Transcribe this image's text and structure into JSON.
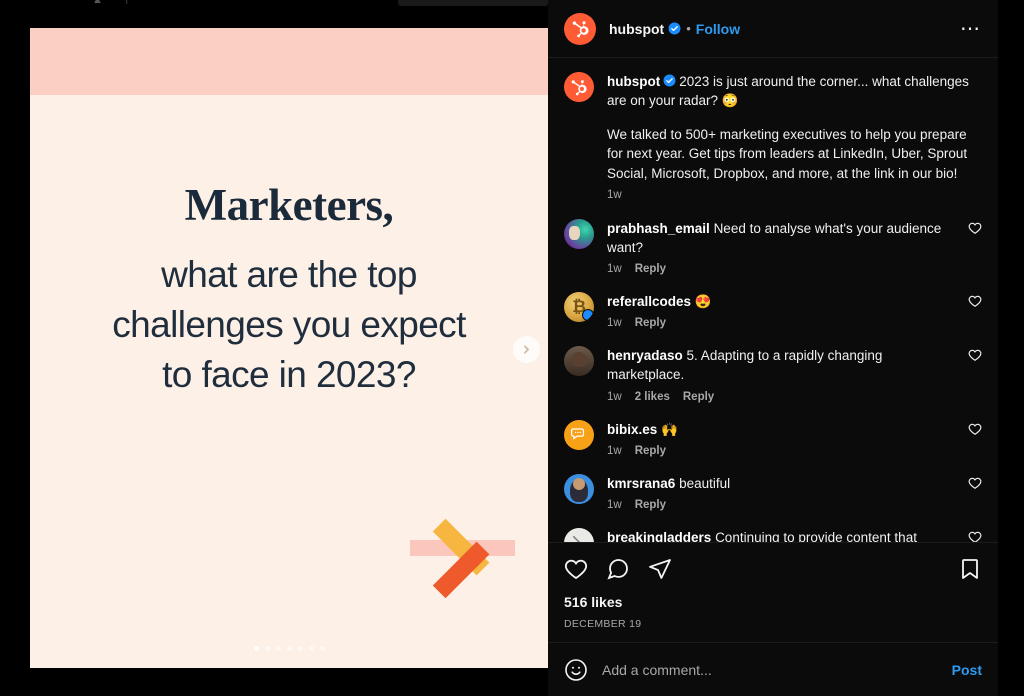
{
  "window": {
    "background": "#000000"
  },
  "stories_strip": {
    "visible_partial": true,
    "avatar_count": 6
  },
  "post_image": {
    "background": "#fdf1e7",
    "band_color": "#fbcfc3",
    "headline_serif": "Marketers,",
    "headline_line1": "what are the top",
    "headline_line2": "challenges you expect",
    "headline_line3": "to face in 2023?",
    "text_color": "#1f2d3d",
    "arrow": {
      "shaft_color": "#fbc7bc",
      "upper_color": "#f6b63f",
      "lower_color": "#ee5a2c"
    },
    "carousel": {
      "total_dots": 7,
      "active_index": 0
    },
    "next_button_icon": "chevron-right-icon"
  },
  "header": {
    "avatar_icon": "hubspot-logo-icon",
    "username": "hubspot",
    "verified_icon": "verified-badge-icon",
    "separator": "•",
    "follow_label": "Follow",
    "more_options_icon": "ellipsis-icon",
    "follow_color": "#2e9bf0"
  },
  "caption": {
    "avatar_icon": "hubspot-logo-icon",
    "username": "hubspot",
    "verified_icon": "verified-badge-icon",
    "line1": "2023 is just around the corner... what challenges are on your radar? 😳",
    "line2": "We talked to 500+ marketing executives to help you prepare for next year. Get tips from leaders at LinkedIn, Uber, Sprout Social, Microsoft, Dropbox, and more, at the link in our bio!",
    "time": "1w"
  },
  "comments": [
    {
      "avatar": "av-prabhash",
      "username": "prabhash_email",
      "text": "Need to analyse what's your audience want?",
      "time": "1w",
      "likes": "",
      "reply": "Reply",
      "like_icon": "heart-outline-icon"
    },
    {
      "avatar": "av-referall",
      "username": "referallcodes",
      "text": "😍",
      "time": "1w",
      "likes": "",
      "reply": "Reply",
      "like_icon": "heart-outline-icon"
    },
    {
      "avatar": "av-henry",
      "username": "henryadaso",
      "text": "5. Adapting to a rapidly changing marketplace.",
      "time": "1w",
      "likes": "2 likes",
      "reply": "Reply",
      "like_icon": "heart-outline-icon"
    },
    {
      "avatar": "av-bibix",
      "username": "bibix.es",
      "text": "🙌",
      "time": "1w",
      "likes": "",
      "reply": "Reply",
      "like_icon": "heart-outline-icon"
    },
    {
      "avatar": "av-kmrsrana",
      "username": "kmrsrana6",
      "text": "beautiful",
      "time": "1w",
      "likes": "",
      "reply": "Reply",
      "like_icon": "heart-outline-icon"
    },
    {
      "avatar": "av-breaking",
      "username": "breakingladders",
      "text": "Continuing to provide content that connects with audiences. (That's a lot of C(s)!)",
      "time": "",
      "likes": "",
      "reply": "",
      "like_icon": "heart-outline-icon"
    }
  ],
  "actions": {
    "like_icon": "heart-outline-icon",
    "comment_icon": "comment-bubble-icon",
    "share_icon": "share-paperplane-icon",
    "save_icon": "bookmark-outline-icon",
    "likes_count": "516 likes",
    "date": "DECEMBER 19"
  },
  "composer": {
    "emoji_icon": "emoji-smiley-icon",
    "placeholder": "Add a comment...",
    "value": "",
    "post_label": "Post",
    "post_color": "#2e9bf0"
  }
}
